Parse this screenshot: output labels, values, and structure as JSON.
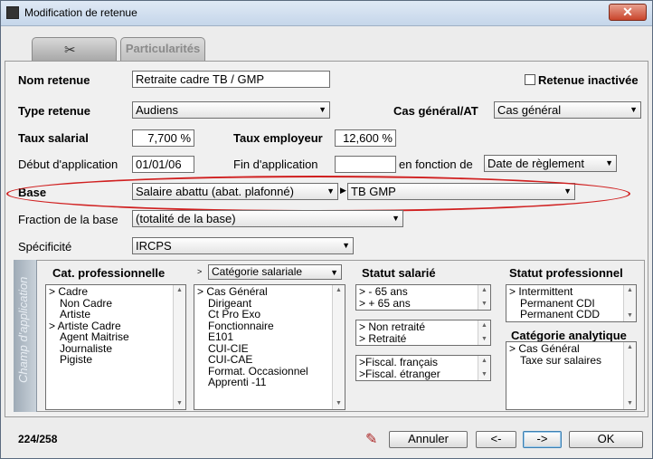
{
  "window": {
    "title": "Modification de retenue",
    "close": "✕"
  },
  "tabs": [
    {
      "label": ""
    },
    {
      "label": "Particularités"
    }
  ],
  "form": {
    "nom_label": "Nom retenue",
    "nom_value": "Retraite cadre TB / GMP",
    "inactive_label": "Retenue inactivée",
    "type_label": "Type retenue",
    "type_value": "Audiens",
    "cas_label": "Cas général/AT",
    "cas_value": "Cas général",
    "taux_sal_label": "Taux salarial",
    "taux_sal_value": "7,700 %",
    "taux_emp_label": "Taux employeur",
    "taux_emp_value": "12,600 %",
    "debut_label": "Début d'application",
    "debut_value": "01/01/06",
    "fin_label": "Fin d'application",
    "fin_value": "",
    "fonction_label": "en fonction de",
    "fonction_value": "Date de règlement",
    "base_label": "Base",
    "base_value": "Salaire abattu (abat. plafonné)",
    "base_sub_value": "TB GMP",
    "fraction_label": "Fraction de la base",
    "fraction_value": "(totalité de la base)",
    "specificite_label": "Spécificité",
    "specificite_value": "IRCPS"
  },
  "champ": {
    "side_label": "Champ d'application",
    "cat_pro_label": "Cat. professionnelle",
    "cat_pro_items": [
      "> Cadre",
      "Non Cadre",
      "Artiste",
      "> Artiste Cadre",
      "Agent Maitrise",
      "Journaliste",
      "Pigiste"
    ],
    "cat_sal_select": "Catégorie salariale",
    "cat_sal_items": [
      "> Cas Général",
      "Dirigeant",
      "Ct Pro Exo",
      "Fonctionnaire",
      "E101",
      "CUI-CIE",
      "CUI-CAE",
      "Format. Occasionnel",
      "Apprenti -11"
    ],
    "statut_sal_label": "Statut salarié",
    "age_items": [
      ">  - 65 ans",
      ">  + 65 ans"
    ],
    "retraite_items": [
      "> Non retraité",
      "> Retraité"
    ],
    "fiscal_items": [
      ">Fiscal. français",
      ">Fiscal. étranger"
    ],
    "statut_pro_label": "Statut professionnel",
    "statut_pro_items": [
      "> Intermittent",
      "Permanent CDI",
      "Permanent CDD"
    ],
    "cat_ana_label": "Catégorie analytique",
    "cat_ana_items": [
      "> Cas Général",
      "Taxe sur salaires"
    ]
  },
  "footer": {
    "counter": "224/258",
    "cancel": "Annuler",
    "prev": "<-",
    "next": "->",
    "ok": "OK"
  }
}
